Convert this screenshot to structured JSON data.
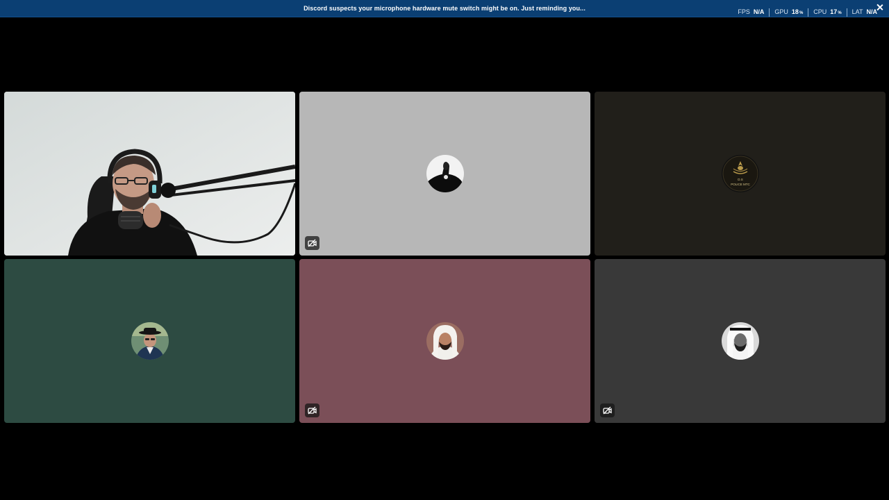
{
  "notice": {
    "message": "Discord suspects your microphone hardware mute switch might be on. Just reminding you..."
  },
  "stats": {
    "fps": {
      "label": "FPS",
      "value": "N/A",
      "unit": ""
    },
    "gpu": {
      "label": "GPU",
      "value": "18",
      "unit": "%"
    },
    "cpu": {
      "label": "CPU",
      "value": "17",
      "unit": "%"
    },
    "lat": {
      "label": "LAT",
      "value": "N/A",
      "unit": ""
    }
  },
  "tiles": [
    {
      "kind": "camera",
      "muted": false,
      "background": "#dfe3e3"
    },
    {
      "kind": "avatar",
      "muted": true,
      "background": "#b7b7b7",
      "avatar_icon": "hand-gesture-avatar"
    },
    {
      "kind": "avatar",
      "muted": false,
      "background": "#211f1a",
      "avatar_icon": "emblem-avatar",
      "avatar_text": [
        "D.S",
        "POLICE MTC"
      ]
    },
    {
      "kind": "avatar",
      "muted": false,
      "background": "#2d4b42",
      "avatar_icon": "man-in-hat-avatar"
    },
    {
      "kind": "avatar",
      "muted": true,
      "background": "#7b4f58",
      "avatar_icon": "man-portrait-avatar"
    },
    {
      "kind": "avatar",
      "muted": true,
      "background": "#393939",
      "avatar_icon": "bw-portrait-avatar"
    }
  ],
  "colors": {
    "notice_bg": "#0b3f73",
    "page_bg": "#000000"
  }
}
